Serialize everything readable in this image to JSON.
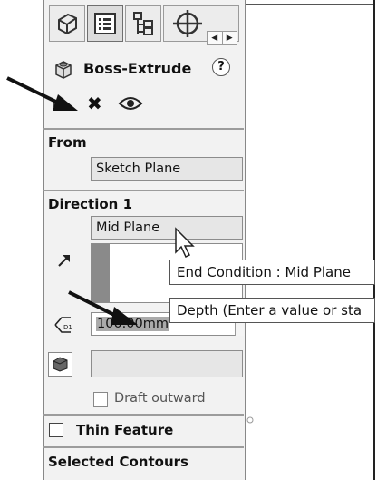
{
  "manager_tabs": [
    {
      "name": "featuremanager-tab",
      "icon": "featuremanager-icon"
    },
    {
      "name": "propertymanager-tab",
      "icon": "propertymanager-icon"
    },
    {
      "name": "configurationmanager-tab",
      "icon": "configurationmanager-icon"
    },
    {
      "name": "dimxpertmanager-tab",
      "icon": "dimxpert-icon"
    }
  ],
  "feature": {
    "title": "Boss-Extrude",
    "help": "?"
  },
  "actions": {
    "ok": "✔",
    "cancel": "✖",
    "preview": "👁"
  },
  "from": {
    "label": "From",
    "value": "Sketch Plane"
  },
  "direction1": {
    "label": "Direction 1",
    "end_condition": "Mid Plane",
    "depth": "100.00mm"
  },
  "tooltips": {
    "end_condition": "End Condition : Mid Plane",
    "depth": "Depth (Enter a value or sta"
  },
  "draft_outward": {
    "label": "Draft outward",
    "checked": false
  },
  "thin_feature": {
    "label": "Thin Feature",
    "checked": false
  },
  "selected_contours": {
    "label": "Selected Contours"
  },
  "colors": {
    "panel_bg": "#f2f2f2",
    "field_bg": "#e6e6e6",
    "direction_bar": "#8a8a8a",
    "arrow": "#111111"
  }
}
